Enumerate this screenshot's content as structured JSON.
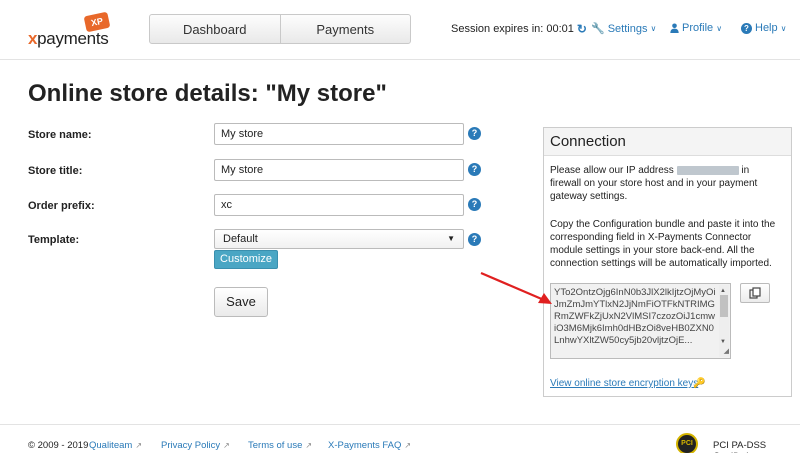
{
  "header": {
    "logo": {
      "text_x": "x",
      "text_rest": "payments",
      "badge": "XP"
    },
    "tabs": [
      {
        "label": "Dashboard"
      },
      {
        "label": "Payments"
      }
    ],
    "session_label": "Session expires in: 00:01",
    "settings_label": "Settings",
    "profile_label": "Profile",
    "help_label": "Help"
  },
  "page": {
    "title": "Online store details: \"My store\""
  },
  "form": {
    "store_name_label": "Store name:",
    "store_name_value": "My store",
    "store_title_label": "Store title:",
    "store_title_value": "My store",
    "order_prefix_label": "Order prefix:",
    "order_prefix_value": "xc",
    "template_label": "Template:",
    "template_value": "Default",
    "customize_label": "Customize",
    "save_label": "Save",
    "help_glyph": "?"
  },
  "connection": {
    "title": "Connection",
    "text1_a": "Please allow our IP address",
    "text1_b": "in firewall on your store host and in your payment gateway settings.",
    "text2": "Copy the Configuration bundle and paste it into the corresponding field in X-Payments Connector module settings in your store back-end. All the connection settings will be automatically imported.",
    "bundle": "YTo2OntzOjg6InN0b3JlX2lkIjtzOjMyOiJmZmJmYTlxN2JjNmFiOTFkNTRIMGRmZWFkZjUxN2VlMSI7czozOiJ1cmwiO3M6Mjk6Imh0dHBzOi8veHB0ZXN0LnhwYXltZW50cy5jb20vljtzOjE...",
    "keys_link": "View online store encryption keys"
  },
  "footer": {
    "copyright": "© 2009 - 2019",
    "qualiteam": "Qualiteam",
    "privacy": "Privacy Policy",
    "terms": "Terms of use",
    "faq": "X-Payments FAQ",
    "pci_badge": "PCI",
    "pci_text": "PCI PA-DSS Certified"
  },
  "colors": {
    "link": "#2a7ab8",
    "brand": "#e8682a",
    "customize": "#4aa6c4",
    "annotation_arrow": "#e02020"
  }
}
